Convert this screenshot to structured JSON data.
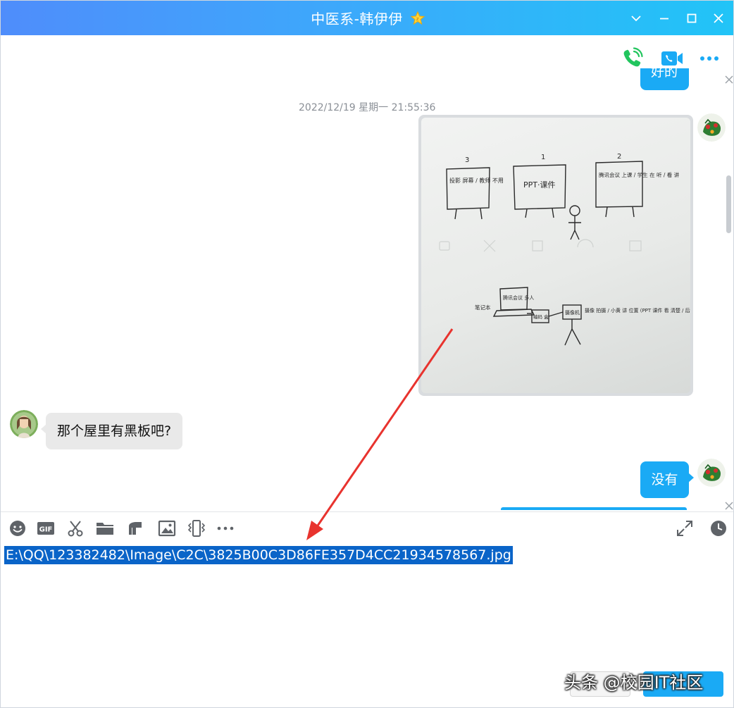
{
  "window": {
    "title": "中医系-韩伊伊",
    "title_badge_icon": "star-badge-icon",
    "controls": [
      "chevron-down-icon",
      "minimize-icon",
      "maximize-icon",
      "close-icon"
    ]
  },
  "chat_actions": [
    "voice-call-icon",
    "video-call-icon",
    "more-icon"
  ],
  "messages": {
    "partial_outgoing_text": "好的",
    "timestamp": "2022/12/19 星期一 21:55:36",
    "incoming_text": "那个屋里有黑板吧?",
    "outgoing_text": "没有"
  },
  "photo_content": {
    "board_numbers": [
      "3",
      "1",
      "2"
    ],
    "board_left_text": "投影 屏幕 / 教师 不用",
    "board_center_text": "PPT·课件",
    "board_right_text": "腾讯会议 上课 / 学生 在 听 / 看 讲",
    "bottom_left_label": "笔记本",
    "laptop_text": "腾讯会议 多人",
    "device_text": "编码 盒",
    "camera_text": "摄像机",
    "bottom_right_text": "摄像 拍摄 / 小黄 讲 位置 (PPT 课件 看 清楚 / 后期 编辑 加入)"
  },
  "toolbar": {
    "tools": [
      "emoji-icon",
      "gif-icon",
      "screenshot-scissors-icon",
      "folder-icon",
      "music-note-icon",
      "image-icon",
      "shake-window-icon",
      "more-icon"
    ],
    "right_tools": [
      "expand-icon",
      "history-clock-icon"
    ]
  },
  "input": {
    "value": "E:\\QQ\\123382482\\Image\\C2C\\3825B00C3D86FE357D4CC21934578567.jpg"
  },
  "footer": {
    "watermark": "头条 @校园IT社区"
  },
  "colors": {
    "title_gradient_start": "#4f8dfb",
    "title_gradient_end": "#21c4f7",
    "outgoing_bubble": "#1aaaf5",
    "incoming_bubble": "#e9e9e9",
    "selection": "#0a64c8",
    "annotation_arrow": "#e8332e"
  }
}
